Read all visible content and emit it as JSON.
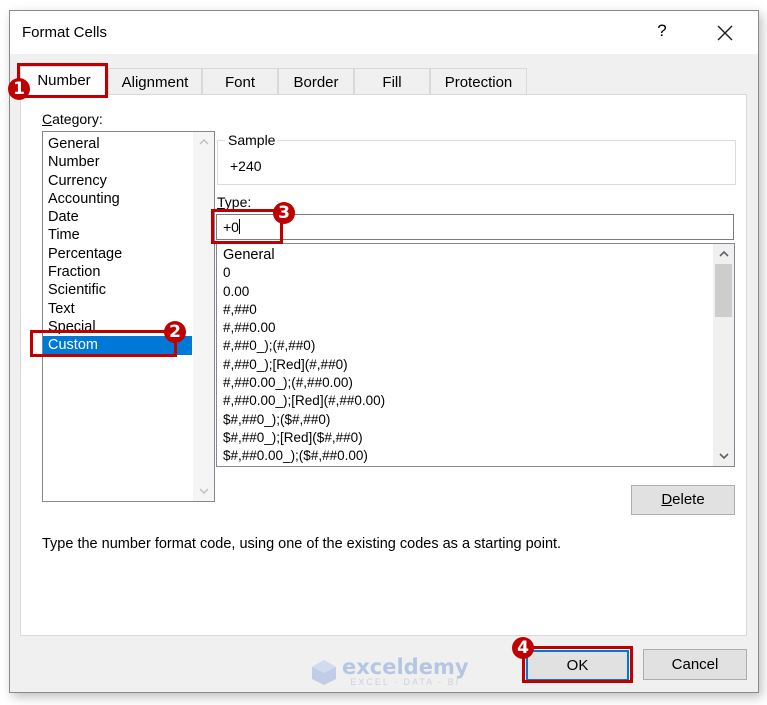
{
  "window": {
    "title": "Format Cells",
    "help_label": "?",
    "close_icon": "close-icon"
  },
  "tabs": [
    {
      "label": "Number",
      "active": true
    },
    {
      "label": "Alignment",
      "active": false
    },
    {
      "label": "Font",
      "active": false
    },
    {
      "label": "Border",
      "active": false
    },
    {
      "label": "Fill",
      "active": false
    },
    {
      "label": "Protection",
      "active": false
    }
  ],
  "category": {
    "label_underlined": "C",
    "label_rest": "ategory:",
    "items": [
      "General",
      "Number",
      "Currency",
      "Accounting",
      "Date",
      "Time",
      "Percentage",
      "Fraction",
      "Scientific",
      "Text",
      "Special",
      "Custom"
    ],
    "selected": "Custom"
  },
  "sample": {
    "label": "Sample",
    "value": "+240"
  },
  "type": {
    "label_underlined": "T",
    "label_rest": "ype:",
    "value": "+0"
  },
  "format_codes": [
    "General",
    "0",
    "0.00",
    "#,##0",
    "#,##0.00",
    "#,##0_);(#,##0)",
    "#,##0_);[Red](#,##0)",
    "#,##0.00_);(#,##0.00)",
    "#,##0.00_);[Red](#,##0.00)",
    "$#,##0_);($#,##0)",
    "$#,##0_);[Red]($#,##0)",
    "$#,##0.00_);($#,##0.00)"
  ],
  "buttons": {
    "delete_underlined": "D",
    "delete_rest": "elete",
    "ok": "OK",
    "cancel": "Cancel"
  },
  "hint": "Type the number format code, using one of the existing codes as a starting point.",
  "annotations": {
    "step1": "1",
    "step2": "2",
    "step3": "3",
    "step4": "4",
    "color": "#c00000"
  },
  "watermark": {
    "name": "exceldemy",
    "tagline": "EXCEL - DATA - BI"
  },
  "colors": {
    "selection": "#0078d7",
    "dialog_bg": "#f0f0f0",
    "highlight": "#c00000"
  }
}
